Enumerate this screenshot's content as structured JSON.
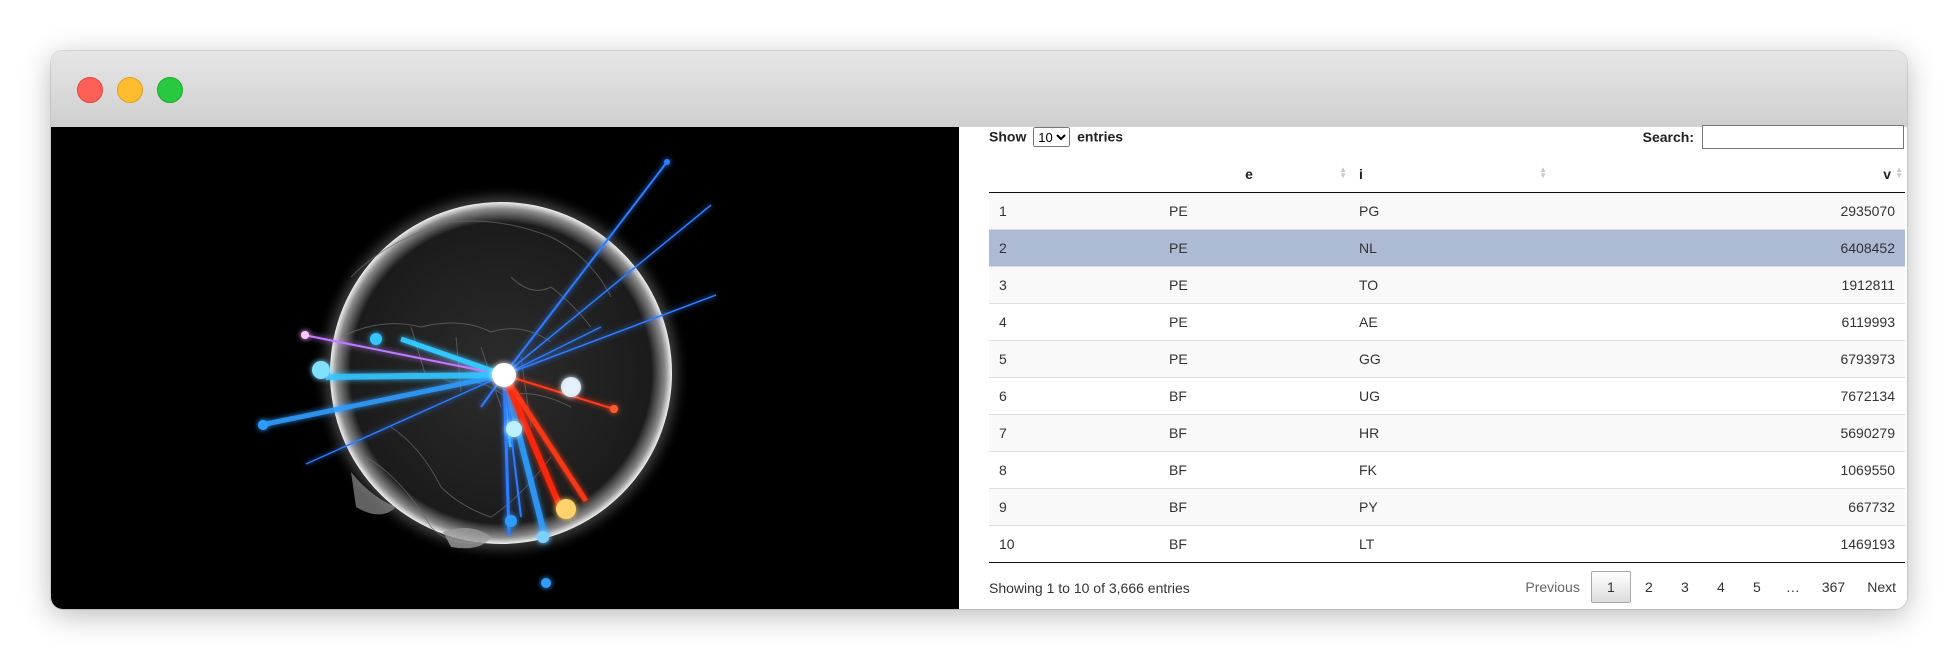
{
  "window": {
    "controls": [
      "close",
      "minimize",
      "zoom"
    ]
  },
  "table_controls": {
    "show_label": "Show",
    "entries_label": "entries",
    "page_length": "10",
    "search_label": "Search:",
    "search_value": ""
  },
  "columns": [
    "",
    "e",
    "i",
    "v"
  ],
  "rows": [
    {
      "idx": "1",
      "e": "PE",
      "i": "PG",
      "v": "2935070"
    },
    {
      "idx": "2",
      "e": "PE",
      "i": "NL",
      "v": "6408452"
    },
    {
      "idx": "3",
      "e": "PE",
      "i": "TO",
      "v": "1912811"
    },
    {
      "idx": "4",
      "e": "PE",
      "i": "AE",
      "v": "6119993"
    },
    {
      "idx": "5",
      "e": "PE",
      "i": "GG",
      "v": "6793973"
    },
    {
      "idx": "6",
      "e": "BF",
      "i": "UG",
      "v": "7672134"
    },
    {
      "idx": "7",
      "e": "BF",
      "i": "HR",
      "v": "5690279"
    },
    {
      "idx": "8",
      "e": "BF",
      "i": "FK",
      "v": "1069550"
    },
    {
      "idx": "9",
      "e": "BF",
      "i": "PY",
      "v": "667732"
    },
    {
      "idx": "10",
      "e": "BF",
      "i": "LT",
      "v": "1469193"
    }
  ],
  "selected_row": 2,
  "info_text": "Showing 1 to 10 of 3,666 entries",
  "pagination": {
    "previous": "Previous",
    "pages": [
      "1",
      "2",
      "3",
      "4",
      "5",
      "…",
      "367"
    ],
    "current": "1",
    "next": "Next"
  },
  "colors": {
    "selected_row": "#acbad4",
    "arc_blue": "#3fa9ff",
    "arc_red": "#ff3a1a"
  }
}
